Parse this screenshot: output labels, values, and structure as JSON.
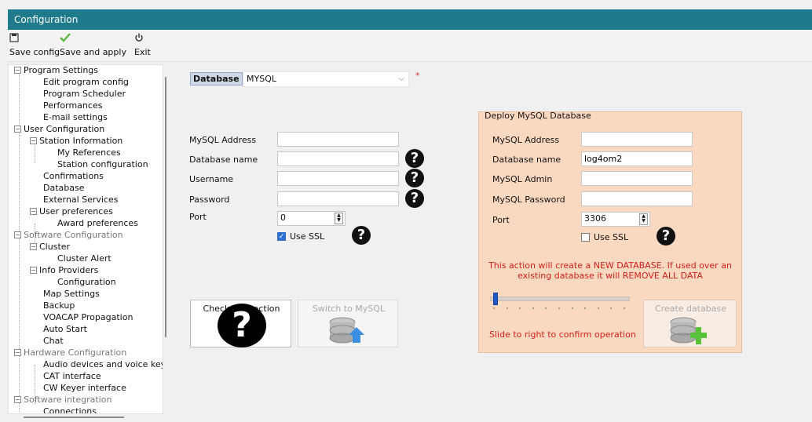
{
  "window": {
    "title": "Configuration"
  },
  "toolbar": {
    "save_config": "Save config",
    "save_apply": "Save and apply",
    "exit": "Exit"
  },
  "tree": {
    "items": [
      "Program Settings",
      "Edit program config",
      "Program Scheduler",
      "Performances",
      "E-mail settings",
      "User Configuration",
      "Station Information",
      "My References",
      "Station configuration",
      "Confirmations",
      "Database",
      "External Services",
      "User preferences",
      "Award preferences",
      "Software Configuration",
      "Cluster",
      "Cluster Alert",
      "Info Providers",
      "Configuration",
      "Map Settings",
      "Backup",
      "VOACAP Propagation",
      "Auto Start",
      "Chat",
      "Hardware Configuration",
      "Audio devices and voice keye",
      "CAT interface",
      "CW Keyer interface",
      "Software integration",
      "Connections"
    ]
  },
  "main": {
    "database_label": "Database",
    "database_value": "MYSQL",
    "required_mark": "*",
    "mysql_address_label": "MySQL Address",
    "mysql_address_value": "",
    "database_name_label": "Database name",
    "database_name_value": "",
    "username_label": "Username",
    "username_value": "",
    "password_label": "Password",
    "password_value": "",
    "port_label": "Port",
    "port_value": "0",
    "use_ssl_label": "Use SSL",
    "use_ssl_checked": true,
    "check_connection_label": "Check connection",
    "switch_label": "Switch to MySQL"
  },
  "deploy": {
    "title": "Deploy MySQL Database",
    "mysql_address_label": "MySQL Address",
    "mysql_address_value": "",
    "database_name_label": "Database name",
    "database_name_value": "log4om2",
    "mysql_admin_label": "MySQL Admin",
    "mysql_admin_value": "",
    "mysql_password_label": "MySQL Password",
    "mysql_password_value": "",
    "port_label": "Port",
    "port_value": "3306",
    "use_ssl_label": "Use SSL",
    "use_ssl_checked": false,
    "warning_line1": "This action will create a NEW DATABASE. If used over an",
    "warning_line2": "existing database it will REMOVE ALL DATA",
    "slider_fraction": 0.0,
    "confirm_text": "Slide to right to confirm operation",
    "create_label": "Create database"
  },
  "colors": {
    "titlebar": "#1f7a8c",
    "deploy_panel": "#fbd9c1",
    "warning": "#d0201a"
  }
}
